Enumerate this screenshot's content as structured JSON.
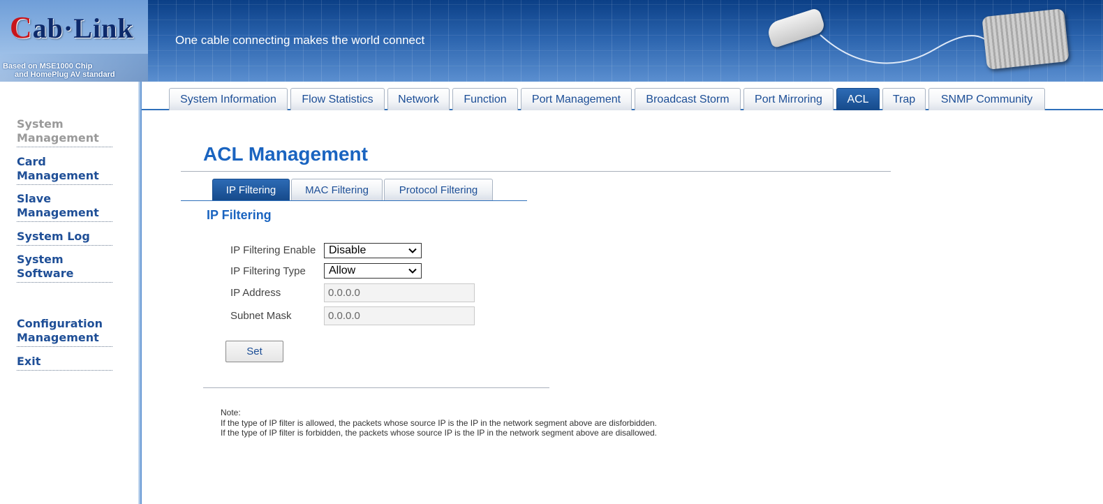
{
  "header": {
    "logo_c": "C",
    "logo_rest": "ab·Link",
    "chip_line1": "Based on MSE1000 Chip",
    "chip_line2": "and HomePlug AV standard",
    "slogan": "One cable connecting makes the world connect"
  },
  "sidebar": {
    "items": [
      {
        "line1": "System",
        "line2": "Management"
      },
      {
        "line1": "Card",
        "line2": "Management"
      },
      {
        "line1": "Slave",
        "line2": "Management"
      },
      {
        "line1": "System Log",
        "line2": ""
      },
      {
        "line1": "System",
        "line2": "Software"
      },
      {
        "line1": "Configuration",
        "line2": "Management"
      },
      {
        "line1": "Exit",
        "line2": ""
      }
    ]
  },
  "tabs": [
    "System Information",
    "Flow Statistics",
    "Network",
    "Function",
    "Port Management",
    "Broadcast Storm",
    "Port Mirroring",
    "ACL",
    "Trap",
    "SNMP Community"
  ],
  "main": {
    "title": "ACL Management",
    "subtabs": [
      "IP Filtering",
      "MAC Filtering",
      "Protocol Filtering"
    ],
    "section_title": "IP Filtering",
    "form": {
      "enable_label": "IP Filtering Enable",
      "enable_value": "Disable",
      "type_label": "IP Filtering Type",
      "type_value": "Allow",
      "ip_label": "IP Address",
      "ip_value": "0.0.0.0",
      "mask_label": "Subnet Mask",
      "mask_value": "0.0.0.0",
      "set_label": "Set"
    },
    "note": {
      "heading": "Note:",
      "line1": "If the type of IP filter is allowed, the packets whose source IP is the IP in the network segment above are disforbidden.",
      "line2": "If the type of IP filter is forbidden, the packets whose source IP is the IP in the network segment above are disallowed."
    }
  }
}
